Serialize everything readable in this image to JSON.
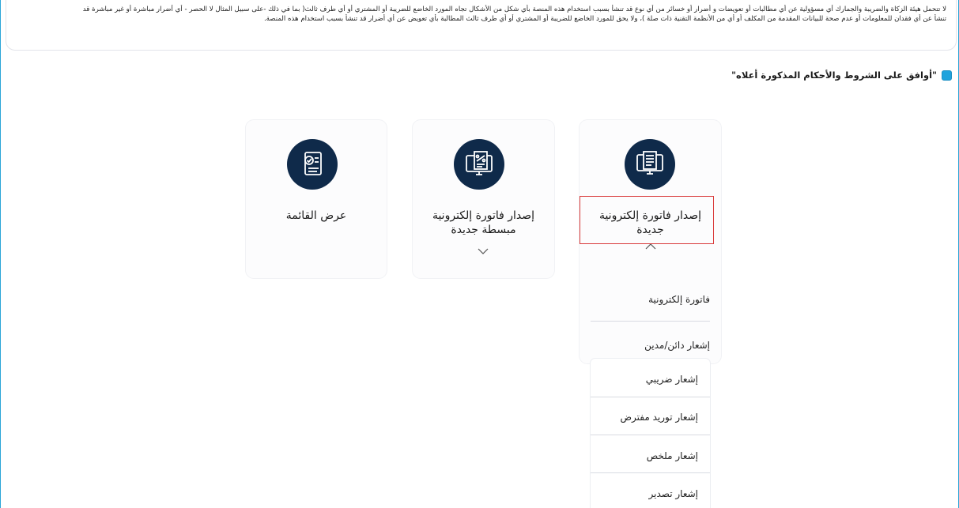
{
  "disclaimer": {
    "line1": "لا تتحمل هيئة الزكاة والضريبة والجمارك أي مسؤولية عن أي مطالبات أو تعويضات و أضرار أو خسائر من أي نوع قد تنشأ بسبب استخدام هذه المنصة بأي شكل من الأشكال تجاه المورد الخاضع للضريبة أو المشتري أو أي طرف ثالث( بما في ذلك -على سبيل المثال لا الحصر - أي أضرار مباشرة أو غير مباشرة قد",
    "line2": "تنشأ عن أي فقدان للمعلومات أو عدم صحة للبيانات المقدمة من المكلف أو أي من الأنظمة التقنية ذات صلة )، ولا يحق للمورد الخاضع للضريبة أو المشتري أو أي طرف ثالث المطالبة بأي تعويض عن أي أضرار قد تنشأ بسبب استخدام هذه المنصة."
  },
  "agree": {
    "label": "\"أوافق على الشروط والأحكام المذكورة أعلاه\"",
    "checked": true
  },
  "cards": {
    "new_invoice": {
      "title_line1": "إصدار فاتورة إلكترونية",
      "title_line2": "جديدة",
      "icon": "invoice-monitor-icon"
    },
    "simplified_invoice": {
      "title_line1": "إصدار فاتورة إلكترونية",
      "title_line2": "مبسطة جديدة",
      "icon": "simplified-invoice-monitor-icon"
    },
    "view_list": {
      "title": "عرض القائمة",
      "icon": "list-check-icon"
    }
  },
  "dropdown": {
    "items": [
      "فاتورة إلكترونية",
      "إشعار دائن/مدين"
    ]
  },
  "submenu": {
    "items": [
      "إشعار ضريبي",
      "إشعار توريد مفترض",
      "إشعار ملخص",
      "إشعار تصدير"
    ]
  },
  "colors": {
    "accent": "#1fa3dd",
    "icon_bg": "#0f2a4a",
    "highlight": "#d93a3a"
  }
}
